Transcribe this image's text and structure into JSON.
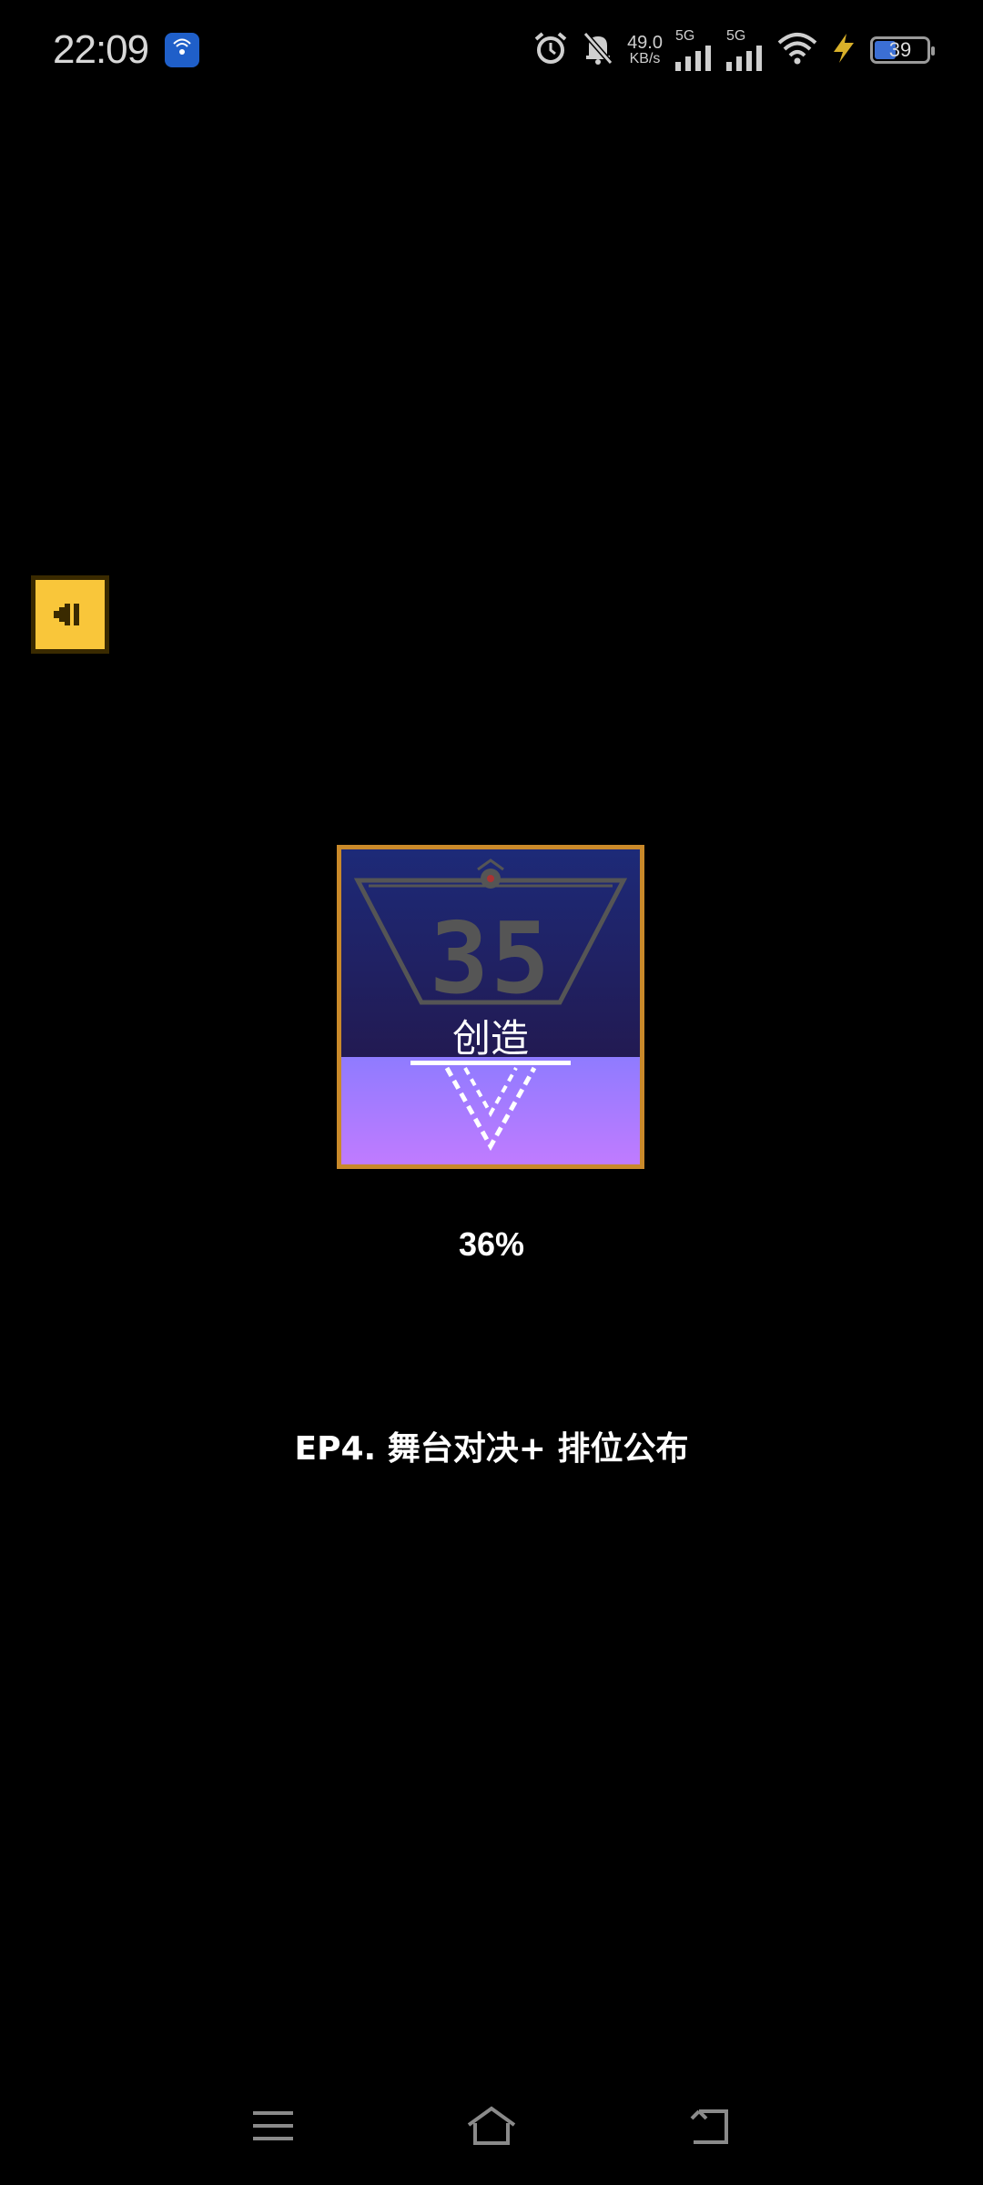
{
  "status_bar": {
    "time": "22:09",
    "hotspot_icon": "hotspot-icon",
    "alarm_icon": "alarm-icon",
    "mute_icon": "bell-muted-icon",
    "net_speed_value": "49.0",
    "net_speed_unit": "KB/s",
    "sim1_label": "5G",
    "sim2_label": "5G",
    "wifi_icon": "wifi-icon",
    "charging_icon": "lightning-icon",
    "battery_percent": "39",
    "battery_level": 0.39
  },
  "back_button": {
    "icon": "back-arrow-icon"
  },
  "emblem": {
    "number": "35",
    "label": "创造"
  },
  "progress": {
    "text": "36%",
    "value": 0.36
  },
  "episode": {
    "title": "EP4. 舞台对决+ 排位公布"
  },
  "nav_bar": {
    "menu_icon": "menu-icon",
    "home_icon": "home-icon",
    "back_icon": "back-icon"
  },
  "colors": {
    "background": "#000000",
    "back_button": "#f9c63a",
    "emblem_border": "#c9892a",
    "emblem_top": "#1d2a78",
    "emblem_bottom": "#c07bff",
    "hotspot_badge": "#1f5fc9"
  }
}
